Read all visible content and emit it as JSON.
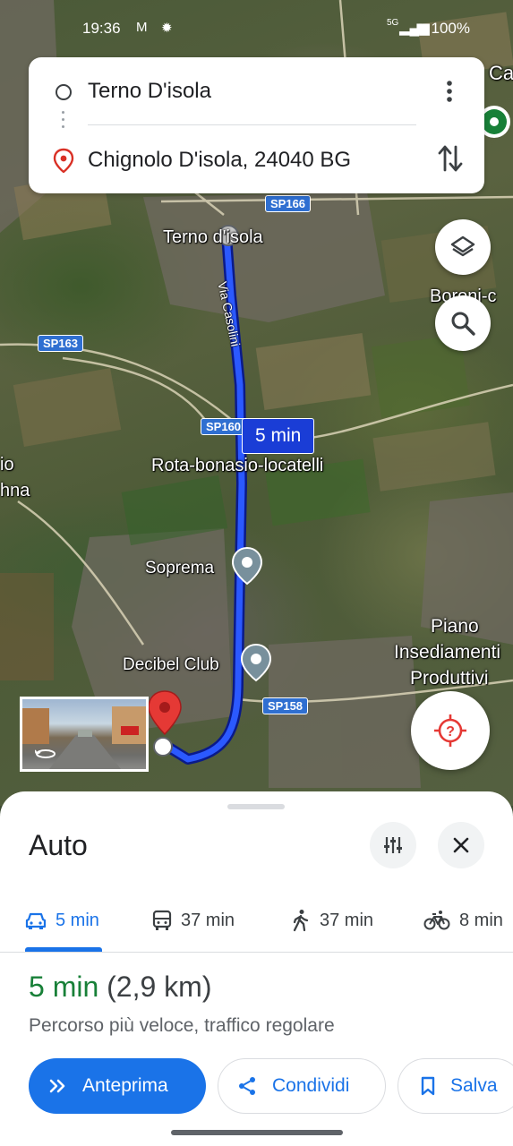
{
  "status_bar": {
    "time": "19:36",
    "battery": "100%",
    "network": "5G"
  },
  "route_card": {
    "origin": "Terno D'isola",
    "destination": "Chignolo D'isola, 24040 BG"
  },
  "map": {
    "place_labels": {
      "terno": "Terno d'isola",
      "rota": "Rota-bonasio-locatelli",
      "soprema": "Soprema",
      "decibel": "Decibel Club",
      "piano_1": "Piano",
      "piano_2": "Insediamenti",
      "piano_3": "Produttivi",
      "boroni": "Boroni-c",
      "cut_left_1": "io",
      "cut_left_2": "hna",
      "cut_top_right": "Ca"
    },
    "road_shields": {
      "sp166": "SP166",
      "sp163": "SP163",
      "sp160": "SP160",
      "sp158": "SP158"
    },
    "road_name": "Via Casolini",
    "eta_bubble": "5 min",
    "route_color": "#1a3dd6"
  },
  "sheet": {
    "title": "Auto",
    "modes": [
      {
        "name": "car",
        "label": "5 min",
        "active": true
      },
      {
        "name": "transit",
        "label": "37 min",
        "active": false
      },
      {
        "name": "walk",
        "label": "37 min",
        "active": false
      },
      {
        "name": "bike",
        "label": "8 min",
        "active": false
      }
    ],
    "summary_duration": "5 min",
    "summary_distance": "(2,9 km)",
    "subtext": "Percorso più veloce, traffico regolare",
    "buttons": {
      "preview": "Anteprima",
      "share": "Condividi",
      "save": "Salva"
    },
    "accent_color": "#1a73e8",
    "duration_color": "#188038"
  }
}
